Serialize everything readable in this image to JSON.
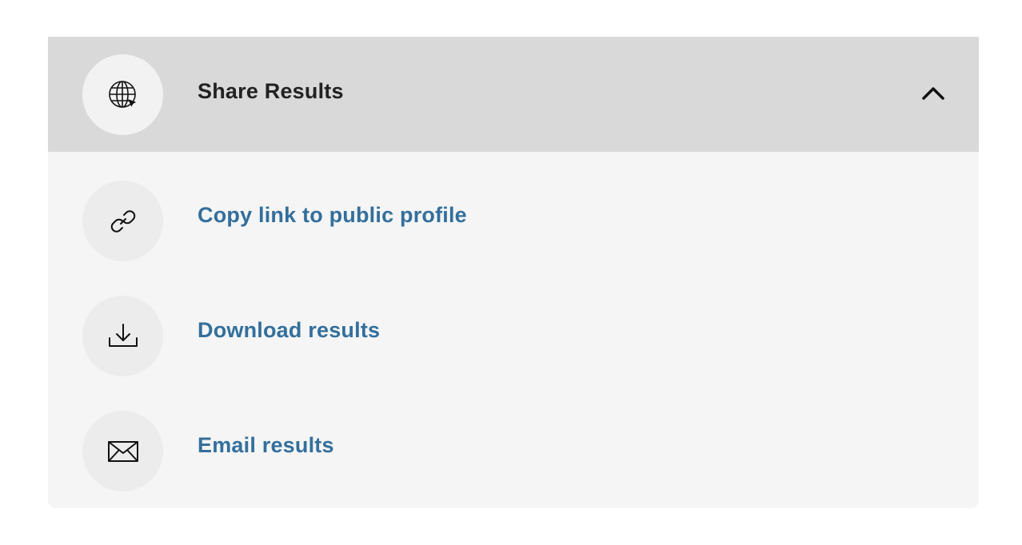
{
  "header": {
    "title": "Share Results",
    "icon": "globe-icon",
    "toggle_icon": "chevron-up-icon"
  },
  "items": [
    {
      "label": "Copy link to public profile",
      "icon": "link-icon"
    },
    {
      "label": "Download results",
      "icon": "download-icon"
    },
    {
      "label": "Email results",
      "icon": "envelope-icon"
    }
  ],
  "colors": {
    "header_bg": "#d9d9d9",
    "panel_bg": "#f5f5f5",
    "link_text": "#336f9c",
    "title_text": "#222222"
  }
}
